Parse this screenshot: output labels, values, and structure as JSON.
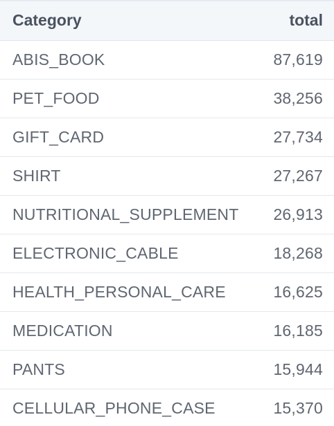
{
  "table": {
    "columns": [
      "Category",
      "total"
    ],
    "rows": [
      {
        "category": "ABIS_BOOK",
        "total": "87,619"
      },
      {
        "category": "PET_FOOD",
        "total": "38,256"
      },
      {
        "category": "GIFT_CARD",
        "total": "27,734"
      },
      {
        "category": "SHIRT",
        "total": "27,267"
      },
      {
        "category": "NUTRITIONAL_SUPPLEMENT",
        "total": "26,913"
      },
      {
        "category": "ELECTRONIC_CABLE",
        "total": "18,268"
      },
      {
        "category": "HEALTH_PERSONAL_CARE",
        "total": "16,625"
      },
      {
        "category": "MEDICATION",
        "total": "16,185"
      },
      {
        "category": "PANTS",
        "total": "15,944"
      },
      {
        "category": "CELLULAR_PHONE_CASE",
        "total": "15,370"
      }
    ]
  }
}
